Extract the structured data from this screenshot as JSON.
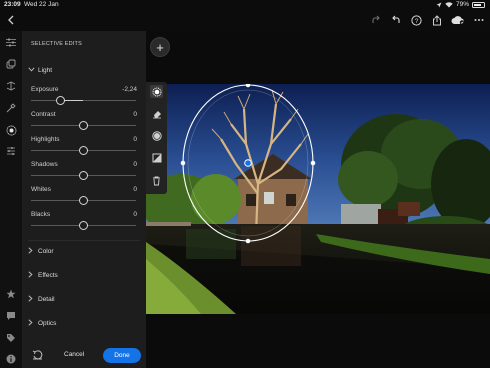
{
  "status": {
    "time": "23:09",
    "date": "Wed 22 Jan",
    "battery": "79%"
  },
  "toolbar": {
    "icons": [
      "back-icon",
      "redo-icon",
      "undo-icon",
      "help-icon",
      "share-icon",
      "cloud-sync-icon",
      "more-icon"
    ]
  },
  "rail": {
    "icons": [
      "sliders-icon",
      "presets-icon",
      "versions-icon",
      "healing-icon",
      "masking-icon",
      "selective-edits-icon",
      "star-icon",
      "comment-icon",
      "tag-icon",
      "info-icon"
    ]
  },
  "panel": {
    "title": "SELECTIVE EDITS",
    "light_section": "Light",
    "sliders": [
      {
        "label": "Exposure",
        "value": "-2,24",
        "position": 0.28
      },
      {
        "label": "Contrast",
        "value": "0",
        "position": 0.5
      },
      {
        "label": "Highlights",
        "value": "0",
        "position": 0.5
      },
      {
        "label": "Shadows",
        "value": "0",
        "position": 0.5
      },
      {
        "label": "Whites",
        "value": "0",
        "position": 0.5
      },
      {
        "label": "Blacks",
        "value": "0",
        "position": 0.5
      }
    ],
    "sections": [
      "Color",
      "Effects",
      "Detail",
      "Optics"
    ]
  },
  "footer": {
    "cancel": "Cancel",
    "done": "Done"
  },
  "canvas": {
    "add_symbol": "+",
    "mask_tools": [
      "radial-gradient-icon",
      "eraser-icon",
      "mask-overlay-icon",
      "invert-icon",
      "delete-icon"
    ]
  },
  "colors": {
    "accent": "#1473e6",
    "panel": "#1d1d1d",
    "background": "#0c0c0c"
  }
}
